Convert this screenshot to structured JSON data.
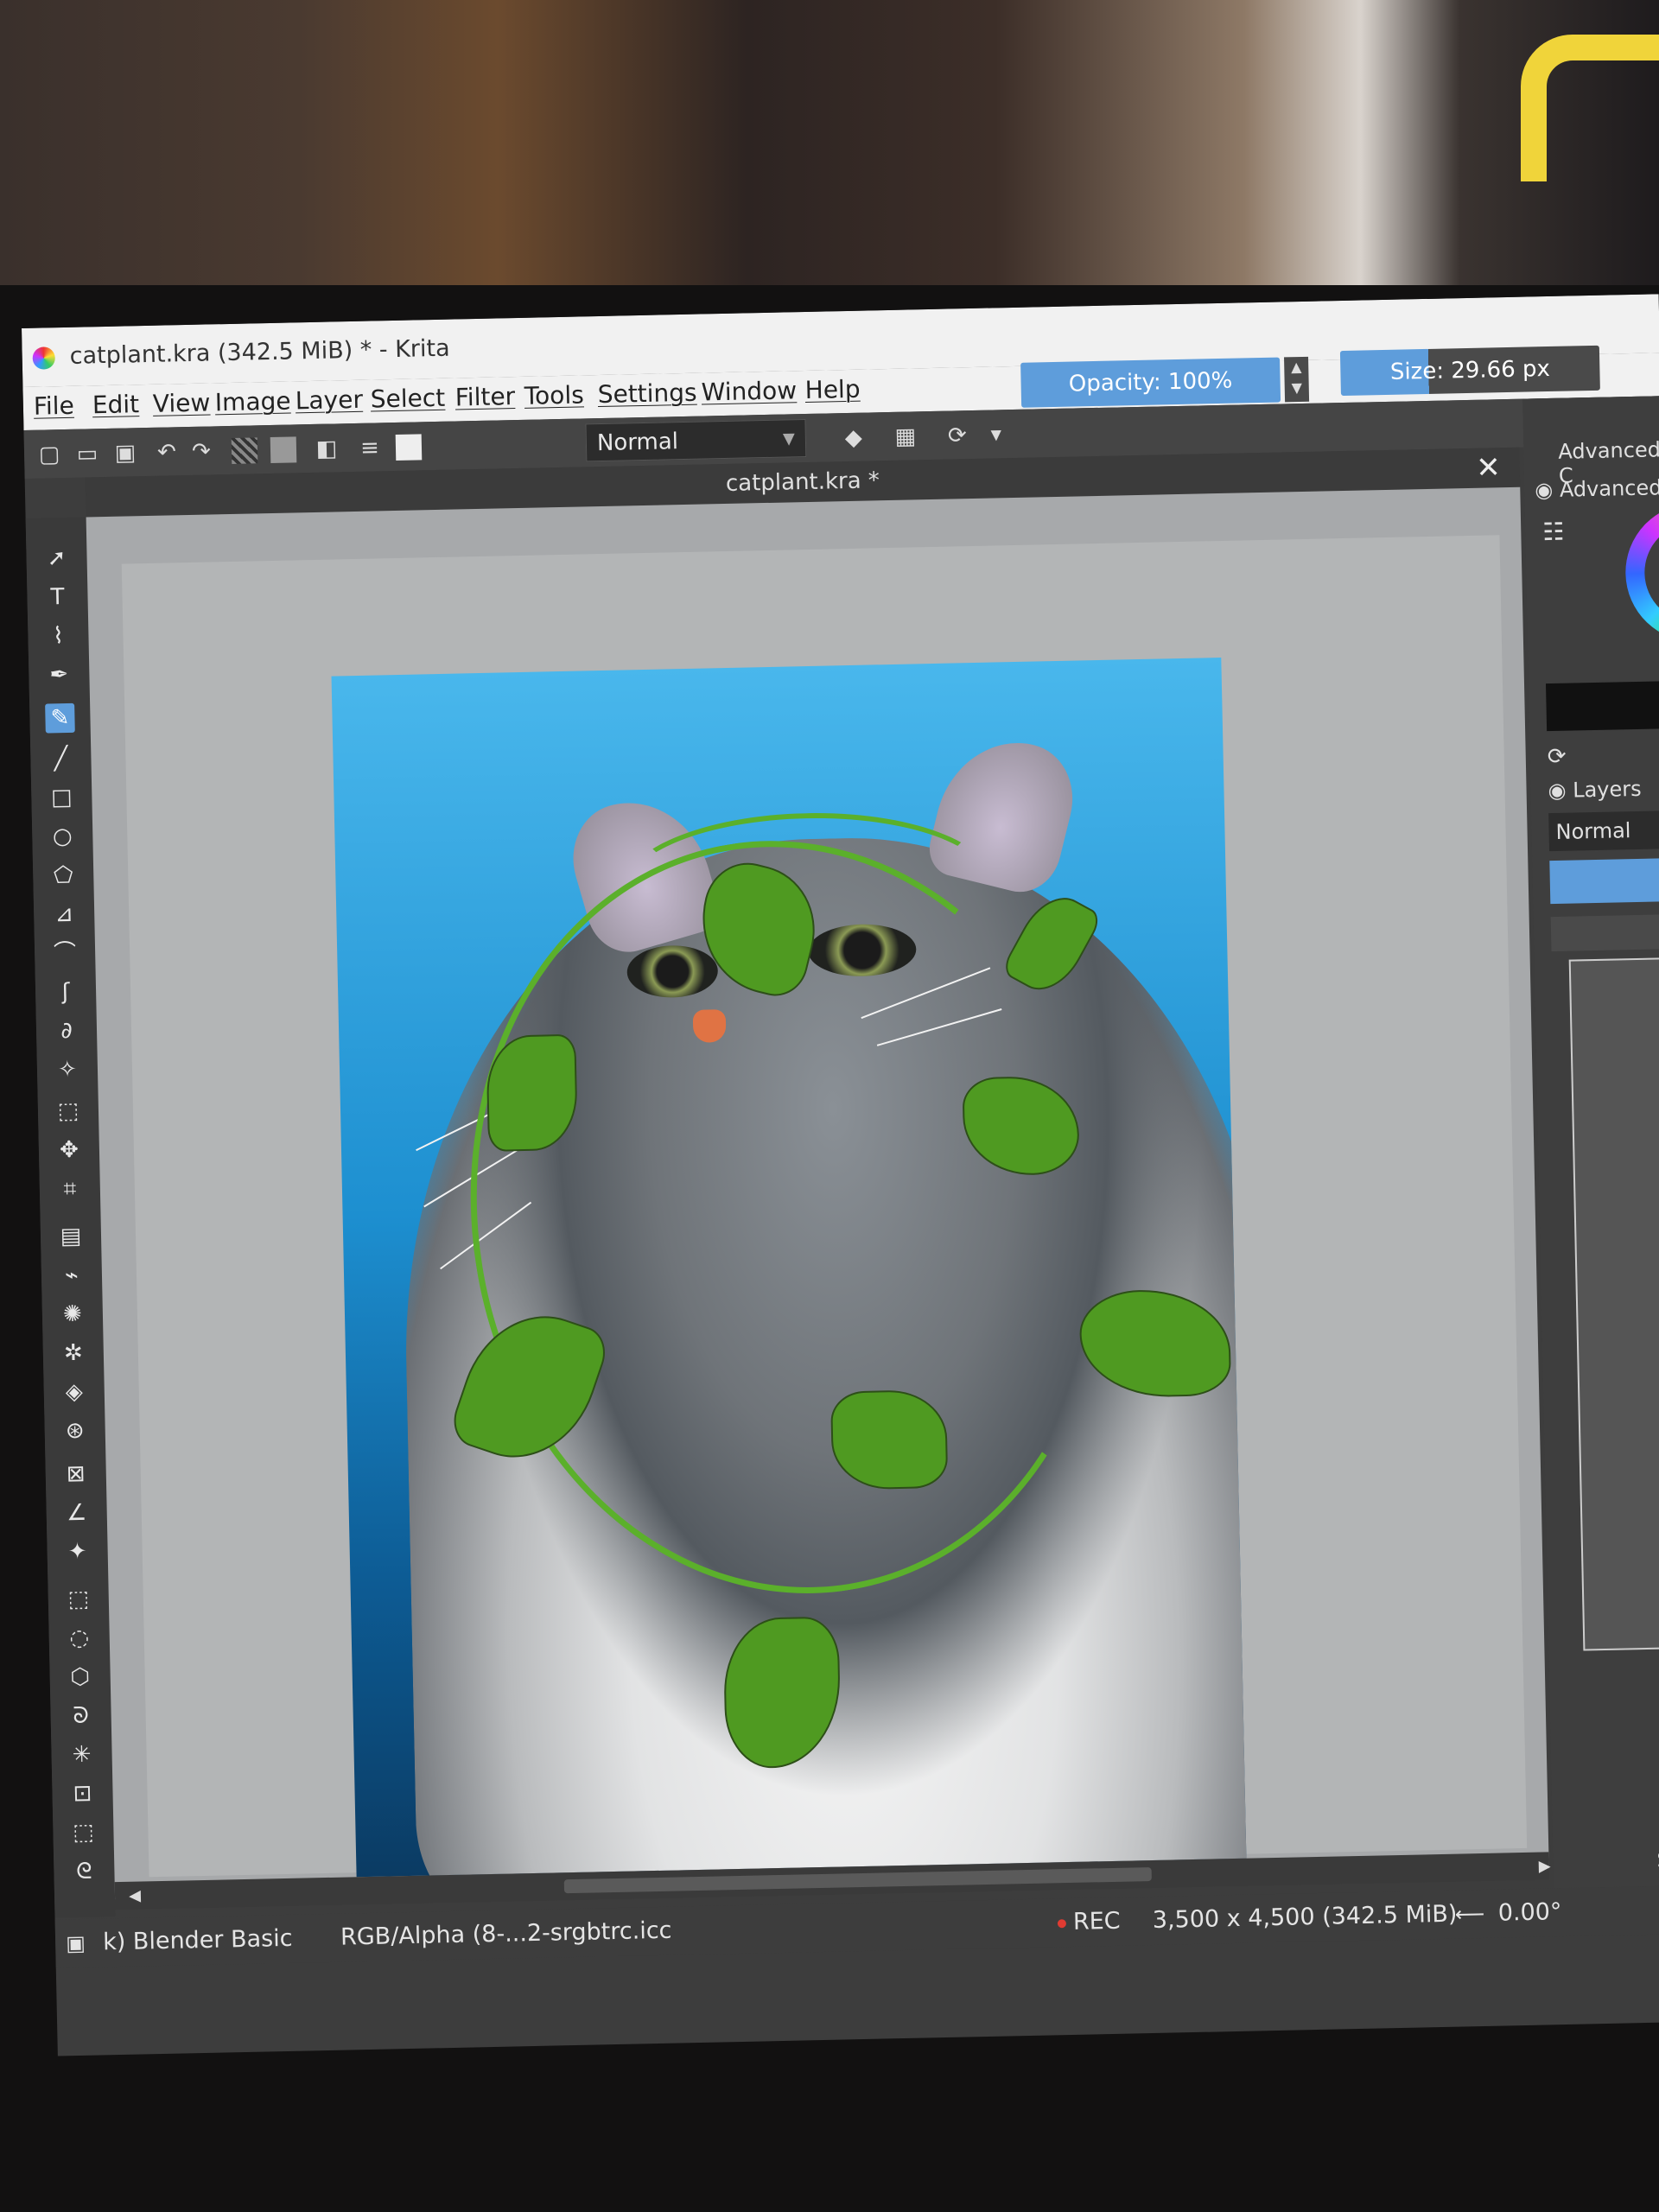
{
  "window": {
    "title": "catplant.kra (342.5 MiB)  * - Krita"
  },
  "menu": {
    "items": [
      "File",
      "Edit",
      "View",
      "Image",
      "Layer",
      "Select",
      "Filter",
      "Tools",
      "Settings",
      "Window",
      "Help"
    ]
  },
  "top_controls": {
    "opacity_label": "Opacity: 100%",
    "size_label": "Size: 29.66 px"
  },
  "toolbar": {
    "blend_mode": "Normal"
  },
  "document_tab": {
    "title": "catplant.kra *"
  },
  "right_dock": {
    "advanced_color_1": "Advanced C",
    "advanced_color_2": "Advanced",
    "layers_title": "Layers",
    "layers_blend_mode": "Normal",
    "bottom_label": "Se"
  },
  "statusbar": {
    "brush_preset": "k) Blender Basic",
    "color_profile": "RGB/Alpha (8-...2-srgbtrc.icc",
    "rec_label": "REC",
    "image_size": "3,500 x 4,500 (342.5 MiB)",
    "rotation": "0.00°"
  },
  "colors": {
    "accent": "#5e9ddb",
    "panel": "#3d3d3d",
    "canvas_bg": "#a7a9ab",
    "vine": "#5bb02b"
  }
}
